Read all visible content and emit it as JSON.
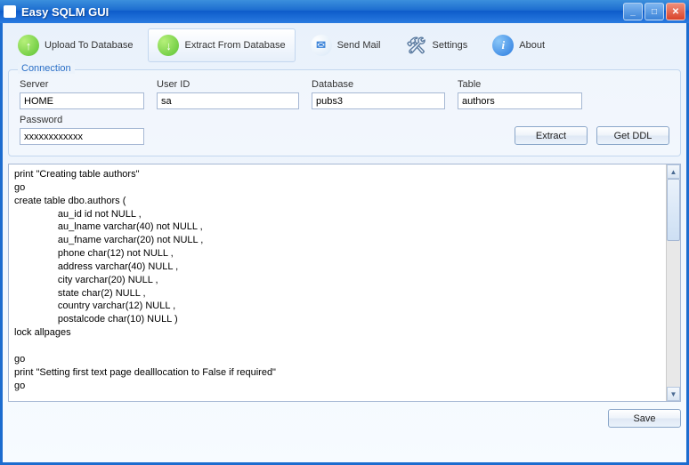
{
  "window": {
    "title": "Easy SQLM GUI"
  },
  "toolbar": {
    "upload": "Upload To Database",
    "extract": "Extract From Database",
    "mail": "Send Mail",
    "settings": "Settings",
    "about": "About"
  },
  "connection": {
    "legend": "Connection",
    "server_label": "Server",
    "server_value": "HOME",
    "userid_label": "User ID",
    "userid_value": "sa",
    "database_label": "Database",
    "database_value": "pubs3",
    "table_label": "Table",
    "table_value": "authors",
    "password_label": "Password",
    "password_value": "xxxxxxxxxxxx",
    "extract_btn": "Extract",
    "getddl_btn": "Get DDL"
  },
  "output": "print \"Creating table authors\"\ngo\ncreate table dbo.authors (\n                au_id id not NULL ,\n                au_lname varchar(40) not NULL ,\n                au_fname varchar(20) not NULL ,\n                phone char(12) not NULL ,\n                address varchar(40) NULL ,\n                city varchar(20) NULL ,\n                state char(2) NULL ,\n                country varchar(12) NULL ,\n                postalcode char(10) NULL )\nlock allpages\n\ngo\nprint \"Setting first text page dealllocation to False if required\"\ngo",
  "footer": {
    "save": "Save"
  }
}
